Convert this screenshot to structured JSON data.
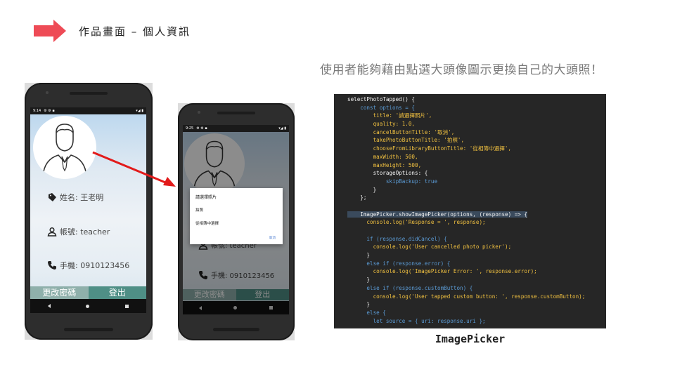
{
  "slide": {
    "title": "作品畫面 – 個人資訊",
    "caption": "使用者能夠藉由點選大頭像圖示更換自己的大頭照！",
    "code_caption": "ImagePicker",
    "accent_color": "#ee4b56"
  },
  "phone_profile": {
    "status_time": "9:14",
    "status_icons": "▾◢ ▮",
    "name_label": "姓名: 王老明",
    "account_label": "帳號: teacher",
    "phone_label": "手機: 0910123456",
    "change_password_button": "更改密碼",
    "logout_button": "登出"
  },
  "phone_dialog": {
    "status_time": "9:25",
    "status_icons": "▾◢ ▮",
    "account_partial": "帳號: teacher",
    "phone_label": "手機: 0910123456",
    "change_password_button": "更改密碼",
    "logout_button": "登出",
    "dialog": {
      "title": "請選擇照片",
      "take_photo": "拍照",
      "choose_library": "從相簿中選擇",
      "cancel": "取消"
    }
  },
  "code": {
    "lines": [
      "selectPhotoTapped() {",
      "    const options = {",
      "        title: '請選擇照片',",
      "        quality: 1.0,",
      "        cancelButtonTitle: '取消',",
      "        takePhotoButtonTitle: '拍照',",
      "        chooseFromLibraryButtonTitle: '從相簿中選擇',",
      "        maxWidth: 500,",
      "        maxHeight: 500,",
      "        storageOptions: {",
      "            skipBackup: true",
      "        }",
      "    };",
      "",
      "    ImagePicker.showImagePicker(options, (response) => {",
      "      console.log('Response = ', response);",
      "",
      "      if (response.didCancel) {",
      "        console.log('User cancelled photo picker');",
      "      }",
      "      else if (response.error) {",
      "        console.log('ImagePicker Error: ', response.error);",
      "      }",
      "      else if (response.customButton) {",
      "        console.log('User tapped custom button: ', response.customButton);",
      "      }",
      "      else {",
      "        let source = { uri: response.uri };"
    ]
  }
}
